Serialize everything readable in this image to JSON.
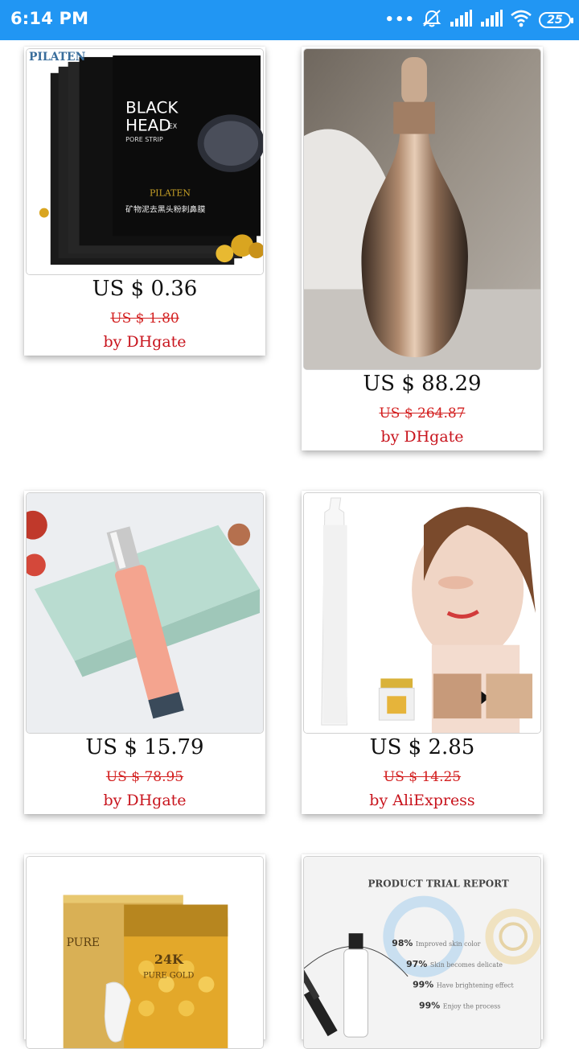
{
  "status_bar": {
    "time": "6:14 PM",
    "more_indicator": "•••",
    "battery": "25",
    "icons": [
      "mute-icon",
      "signal-icon",
      "signal-icon",
      "wifi-icon",
      "battery-icon"
    ]
  },
  "products": [
    {
      "price": "US $ 0.36",
      "original_price": "US $ 1.80",
      "seller": "by DHgate",
      "image": {
        "brand": "PILATEN",
        "brand_small": "PILATEN",
        "line1": "BLACK",
        "line2": "HEAD",
        "ex": "EX",
        "line3": "PORE STRIP",
        "cn_text": "矿物泥去黑头粉刺鼻膜"
      }
    },
    {
      "price": "US $ 88.29",
      "original_price": "US $ 264.87",
      "seller": "by DHgate"
    },
    {
      "price": "US $ 15.79",
      "original_price": "US $ 78.95",
      "seller": "by DHgate"
    },
    {
      "price": "US $ 2.85",
      "original_price": "US $ 14.25",
      "seller": "by AliExpress"
    },
    {
      "image": {
        "line1": "24K",
        "line2": "PURE GOLD",
        "box_text": "PURE"
      }
    },
    {
      "image": {
        "title": "PRODUCT TRIAL REPORT",
        "stats": [
          {
            "pct": "98%",
            "text": "Improved skin color"
          },
          {
            "pct": "97%",
            "text": "Skin becomes delicate"
          },
          {
            "pct": "99%",
            "text": "Have brightening effect"
          },
          {
            "pct": "99%",
            "text": "Enjoy the process"
          }
        ]
      }
    }
  ]
}
